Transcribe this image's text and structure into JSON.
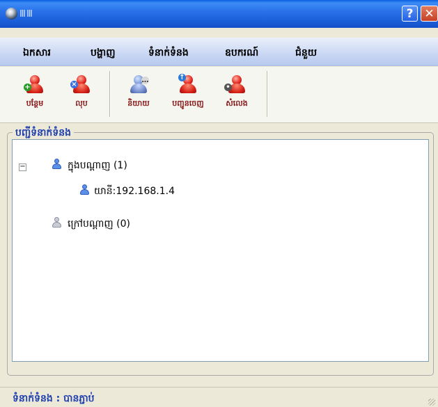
{
  "window": {
    "title": "ⅢⅢ",
    "help_label": "?",
    "close_label": "✕"
  },
  "menu": [
    "ឯកសារ",
    "បង្ហាញ",
    "ទំនាក់ទំនង",
    "ឧបករណ៍",
    "ជំនួយ"
  ],
  "toolbar": [
    {
      "label": "បន្ថែម",
      "icon": "add-user-icon"
    },
    {
      "label": "លុប",
      "icon": "delete-user-icon"
    },
    {
      "label": "និយាយ",
      "icon": "chat-user-icon"
    },
    {
      "label": "បញ្ជូនចេញ",
      "icon": "send-user-icon"
    },
    {
      "label": "សំលេង",
      "icon": "voice-user-icon"
    }
  ],
  "panel": {
    "title": "បញ្ជីទំនាក់ទំនង"
  },
  "tree": {
    "online": {
      "label": "ក្នុងបណ្ដាញ (1)",
      "expander": "−"
    },
    "online_child": {
      "label": "យានី:192.168.1.4"
    },
    "offline": {
      "label": "ក្រៅបណ្ដាញ (0)"
    }
  },
  "status": {
    "text": "ទំនាក់ទំនង : បានភ្ជាប់"
  },
  "colors": {
    "title_bar": "#1c5fd8",
    "accent_text": "#1f3fae",
    "toolbar_label": "#8a1c1c"
  }
}
